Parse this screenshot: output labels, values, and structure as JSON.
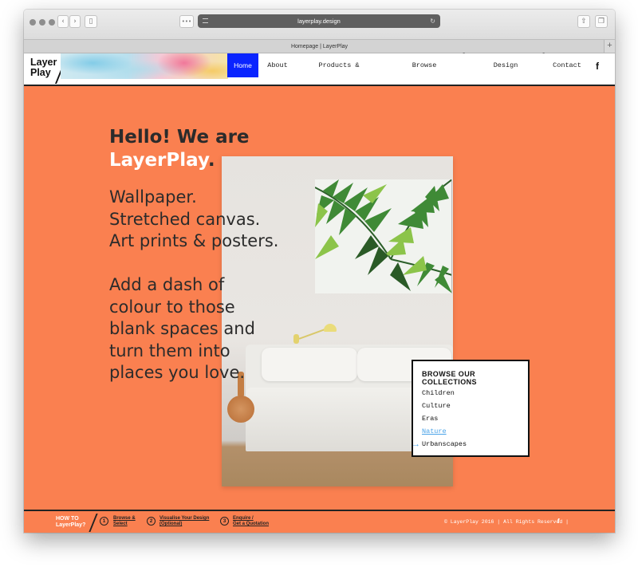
{
  "browser": {
    "url": "layerplay.design",
    "tab_title": "Homepage | LayerPlay",
    "dots_label": "•••",
    "new_tab_label": "+"
  },
  "site": {
    "logo_line1": "Layer",
    "logo_line2": "Play",
    "nav": [
      {
        "label": "Home",
        "active": true
      },
      {
        "label": "About"
      },
      {
        "label": "Products & Services"
      },
      {
        "label": "Browse Collections",
        "has_dropdown": true
      },
      {
        "label": "Design Visualiser",
        "has_dropdown": true
      },
      {
        "label": "Contact"
      }
    ],
    "facebook_label": "f"
  },
  "hero": {
    "hello_line": "Hello! We are",
    "brand": "LayerPlay",
    "brand_punct": ".",
    "products": [
      "Wallpaper.",
      "Stretched canvas.",
      "Art prints & posters."
    ],
    "tagline": [
      "Add a dash of",
      "colour to those",
      "blank spaces and",
      "turn them into",
      "places you love."
    ]
  },
  "collections": {
    "title": "BROWSE OUR COLLECTIONS",
    "items": [
      {
        "label": "Children"
      },
      {
        "label": "Culture"
      },
      {
        "label": "Eras"
      },
      {
        "label": "Nature",
        "active": true
      },
      {
        "label": "Urbanscapes"
      }
    ]
  },
  "footer": {
    "howto_line1": "HOW TO",
    "howto_line2": "LayerPlay?",
    "steps": [
      {
        "num": "1",
        "line1": "Browse &",
        "line2": "Select"
      },
      {
        "num": "2",
        "line1": "Visualise Your Design",
        "line2": "(Optional)"
      },
      {
        "num": "3",
        "line1": "Enquire /",
        "line2": "Get a Quotation"
      }
    ],
    "copyright": "© LayerPlay 2016 | All Rights Reserved |",
    "facebook_label": "f"
  },
  "colors": {
    "accent_orange": "#fa8050",
    "nav_active_blue": "#0a24ff",
    "link_blue": "#4aa3e8"
  }
}
